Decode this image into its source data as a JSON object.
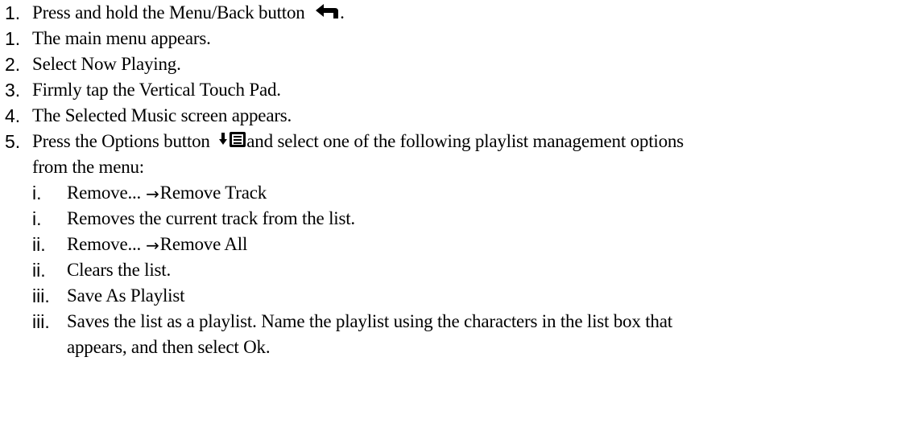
{
  "steps": [
    {
      "num": "1.",
      "text_before": "Press and hold the Menu/Back button",
      "icon": "back-arrow-icon",
      "text_after": "."
    },
    {
      "num": "1.",
      "text": "The main menu appears."
    },
    {
      "num": "2.",
      "text": "Select Now Playing."
    },
    {
      "num": "3.",
      "text": "Firmly tap the Vertical Touch Pad."
    },
    {
      "num": "4.",
      "text": "The Selected Music screen appears."
    },
    {
      "num": "5.",
      "text_before": "Press the Options button",
      "icon": "options-icon",
      "text_after": "and select one of the following playlist management options",
      "text_cont": "from the menu:"
    }
  ],
  "substeps": [
    {
      "num": "i.",
      "text_before": "Remove...",
      "arrow": "→",
      "text_after": "Remove Track"
    },
    {
      "num": "i.",
      "text": "Removes the current track from the list."
    },
    {
      "num": "ii.",
      "text_before": "Remove...",
      "arrow": "→",
      "text_after": "Remove All"
    },
    {
      "num": "ii.",
      "text": "Clears the list."
    },
    {
      "num": "iii.",
      "text": "Save As Playlist"
    },
    {
      "num": "iii.",
      "text": "Saves the list as a playlist. Name the playlist using the characters in the list box that",
      "text_cont": "appears, and then select Ok."
    }
  ]
}
